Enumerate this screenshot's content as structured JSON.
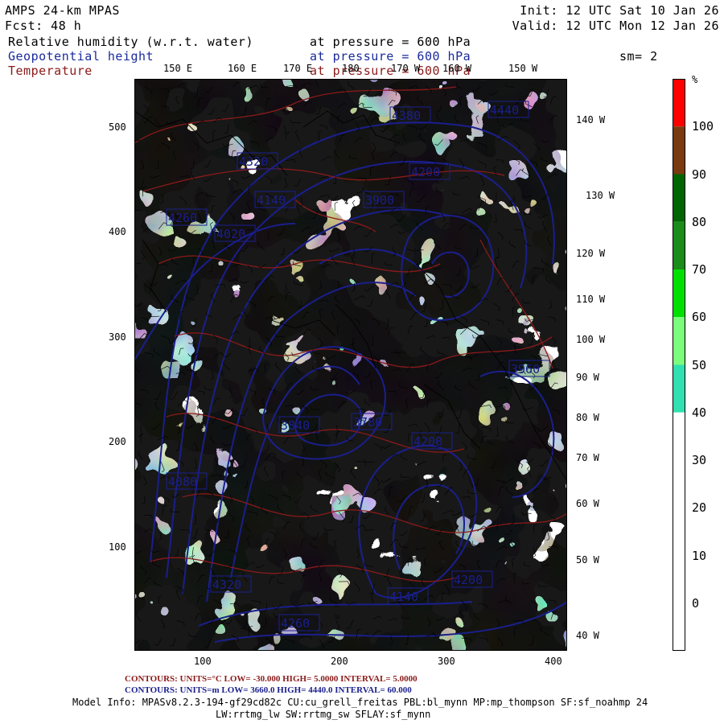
{
  "header": {
    "title_left": "AMPS 24-km MPAS",
    "forecast": "Fcst:   48 h",
    "init": "Init: 12 UTC Sat 10 Jan 26",
    "valid": "Valid: 12 UTC Mon 12 Jan 26",
    "sm": "sm= 2"
  },
  "fields": [
    {
      "name": "Relative humidity (w.r.t. water)",
      "pressure": "at pressure =  600 hPa",
      "color": "#000000"
    },
    {
      "name": "Geopotential height",
      "pressure": "at pressure =  600 hPa",
      "color": "#1a2a9c"
    },
    {
      "name": "Temperature",
      "pressure": "at pressure =  600 hPa",
      "color": "#8b1a1a"
    }
  ],
  "map": {
    "top_lon_labels": [
      "150 E",
      "160 E",
      "170 E",
      "180",
      "170 W",
      "160 W",
      "150 W"
    ],
    "right_lon_labels": [
      "140 W",
      "130 W",
      "120 W",
      "110 W",
      "100 W",
      "90 W",
      "80 W",
      "70 W",
      "60 W",
      "50 W",
      "40 W"
    ],
    "y_ticks": [
      "500",
      "400",
      "300",
      "200",
      "100"
    ],
    "x_ticks": [
      "100",
      "200",
      "300",
      "400"
    ],
    "height_labels": [
      "4380",
      "4320",
      "4260",
      "4200",
      "4140",
      "4080",
      "4020",
      "3960",
      "3900",
      "3840",
      "3780",
      "4440"
    ],
    "land_color": "#ffffff",
    "contour_blue": "#1a1f8c",
    "contour_red": "#8b1a1a"
  },
  "colorbar": {
    "unit": "%",
    "labels": [
      "100",
      "90",
      "80",
      "70",
      "60",
      "50",
      "40",
      "30",
      "20",
      "10",
      "0"
    ],
    "bands": [
      {
        "color": "#ff0000"
      },
      {
        "color": "#7a3a10"
      },
      {
        "color": "#006400"
      },
      {
        "color": "#1a8c1a"
      },
      {
        "color": "#00e000"
      },
      {
        "color": "#7cfc7c"
      },
      {
        "color": "#30e0b0"
      },
      {
        "color": "#ffffff"
      },
      {
        "color": "#ffffff"
      },
      {
        "color": "#ffffff"
      },
      {
        "color": "#ffffff"
      },
      {
        "color": "#ffffff"
      }
    ]
  },
  "footer": {
    "temp_contours": "CONTOURS:  UNITS=°C  LOW= -30.000        HIGH=  5.0000        INTERVAL=   5.0000",
    "height_contours": "CONTOURS:  UNITS=m  LOW=  3660.0        HIGH= 4440.0        INTERVAL=   60.000",
    "model_info_1": "Model Info: MPASv8.2.3-194-gf29cd82c CU:cu_grell_freitas PBL:bl_mynn MP:mp_thompson SF:sf_noahmp 24",
    "model_info_2": "LW:rrtmg_lw SW:rrtmg_sw SFLAY:sf_mynn"
  }
}
